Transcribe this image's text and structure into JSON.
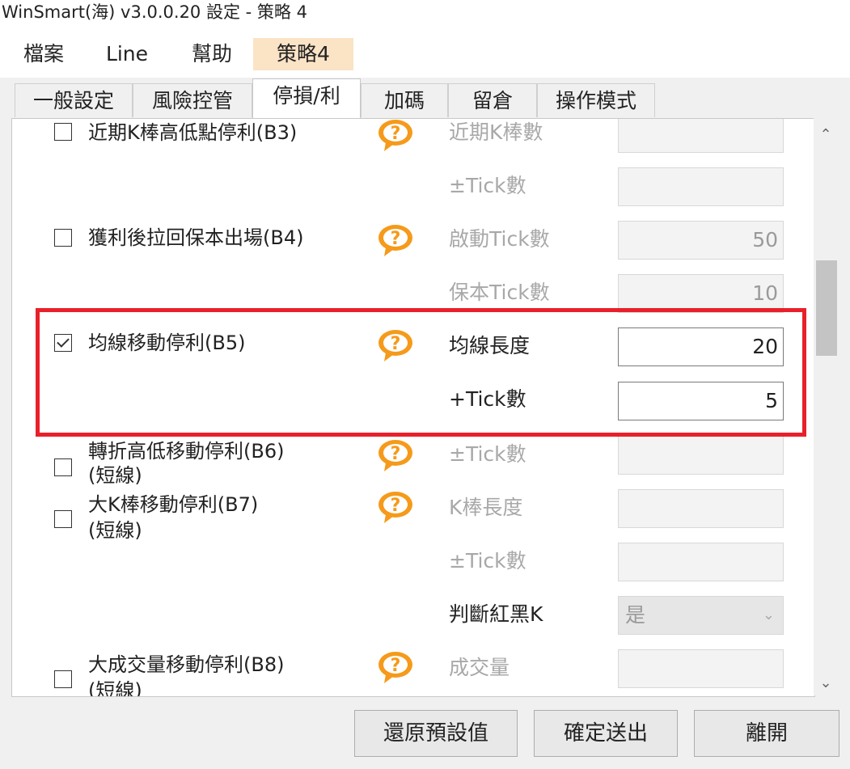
{
  "window": {
    "title": "WinSmart(海) v3.0.0.20 設定 - 策略 4"
  },
  "menu": {
    "items": [
      "檔案",
      "Line",
      "幫助",
      "策略4"
    ],
    "active_index": 3
  },
  "tabs": {
    "items": [
      "一般設定",
      "風險控管",
      "停損/利",
      "加碼",
      "留倉",
      "操作模式"
    ],
    "active_index": 2
  },
  "options": [
    {
      "label": "近期K棒高低點停利(B3)",
      "checked": false,
      "fields": [
        {
          "label": "近期K棒數",
          "value": ""
        },
        {
          "label": "±Tick數",
          "value": ""
        }
      ]
    },
    {
      "label": "獲利後拉回保本出場(B4)",
      "checked": false,
      "fields": [
        {
          "label": "啟動Tick數",
          "value": "50"
        },
        {
          "label": "保本Tick數",
          "value": "10"
        }
      ]
    },
    {
      "label": "均線移動停利(B5)",
      "checked": true,
      "fields": [
        {
          "label": "均線長度",
          "value": "20"
        },
        {
          "label": "+Tick數",
          "value": "5"
        }
      ]
    },
    {
      "label_lines": [
        "轉折高低移動停利(B6)",
        "(短線)"
      ],
      "checked": false,
      "fields": [
        {
          "label": "±Tick數",
          "value": ""
        }
      ]
    },
    {
      "label_lines": [
        "大K棒移動停利(B7)",
        "(短線)"
      ],
      "checked": false,
      "fields": [
        {
          "label": "K棒長度",
          "value": ""
        },
        {
          "label": "±Tick數",
          "value": ""
        },
        {
          "label": "判斷紅黑K",
          "value": "是",
          "type": "select"
        }
      ]
    },
    {
      "label_lines": [
        "大成交量移動停利(B8)",
        "(短線)"
      ],
      "checked": false,
      "fields": [
        {
          "label": "成交量",
          "value": ""
        }
      ]
    }
  ],
  "buttons": {
    "restore": "還原預設值",
    "confirm": "確定送出",
    "leave": "離開"
  },
  "colors": {
    "highlight": "#e8202a",
    "help_icon": "#f59a1a",
    "active_menu": "#fbe3c6"
  }
}
